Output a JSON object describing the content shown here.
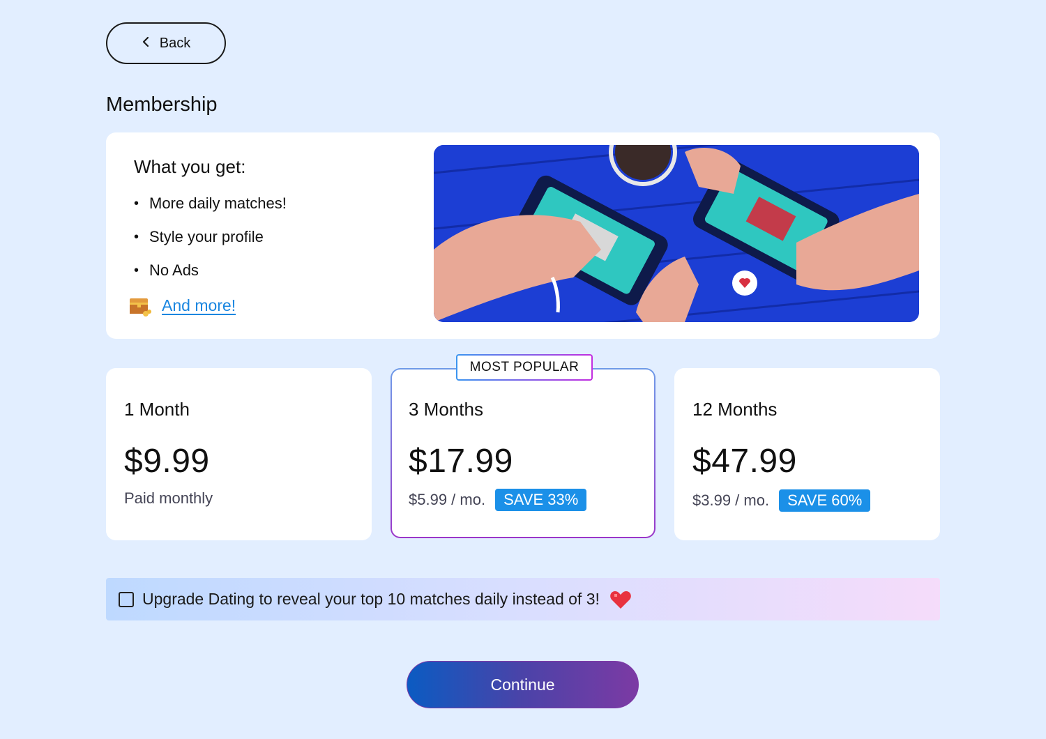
{
  "nav": {
    "back_label": "Back"
  },
  "page": {
    "title": "Membership"
  },
  "features": {
    "heading": "What you get:",
    "items": [
      "More daily matches!",
      "Style your profile",
      "No Ads"
    ],
    "more_link": "And more!"
  },
  "plans": [
    {
      "name": "1 Month",
      "price": "$9.99",
      "subtitle": "Paid monthly",
      "badge": ""
    },
    {
      "name": "3 Months",
      "price": "$17.99",
      "subtitle": "$5.99 / mo.",
      "badge": "SAVE 33%",
      "tag": "MOST POPULAR"
    },
    {
      "name": "12 Months",
      "price": "$47.99",
      "subtitle": "$3.99 / mo.",
      "badge": "SAVE 60%"
    }
  ],
  "upsell": {
    "text": "Upgrade Dating to reveal your top 10 matches daily instead of 3!",
    "checked": false
  },
  "cta": {
    "continue_label": "Continue"
  },
  "colors": {
    "accent": "#1b90e8",
    "background": "#e2eeff",
    "link": "#1a86e0"
  }
}
